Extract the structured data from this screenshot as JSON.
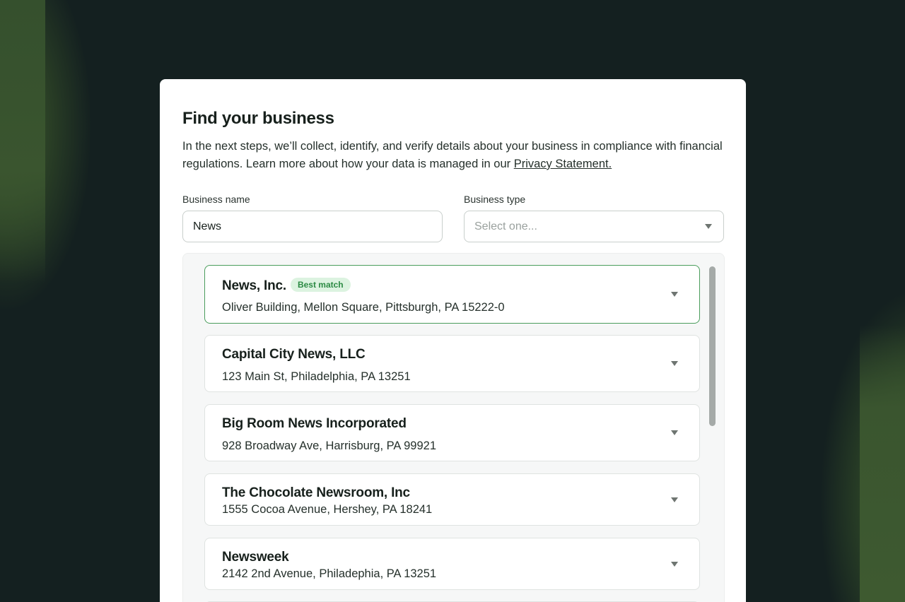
{
  "dialog": {
    "title": "Find your business",
    "intro_text": "In the next steps, we’ll collect, identify, and verify details about your business in compliance with financial regulations. Learn more about how your data is managed in our ",
    "privacy_link": "Privacy Statement."
  },
  "form": {
    "business_name_label": "Business name",
    "business_name_value": "News",
    "business_type_label": "Business type",
    "business_type_placeholder": "Select one..."
  },
  "results": [
    {
      "name": "News, Inc.",
      "badge": "Best match",
      "address": "Oliver Building, Mellon Square, Pittsburgh, PA 15222-0"
    },
    {
      "name": "Capital City News, LLC",
      "address": "123 Main St, Philadelphia, PA 13251"
    },
    {
      "name": "Big Room News Incorporated",
      "address": "928 Broadway Ave, Harrisburg, PA 99921"
    },
    {
      "name": "The Chocolate Newsroom, Inc",
      "address": "1555 Cocoa Avenue, Hershey, PA 18241"
    },
    {
      "name": "Newsweek",
      "address": "2142 2nd Avenue, Philadephia, PA 13251"
    }
  ],
  "colors": {
    "background": "#142020",
    "accent_green": "#4a9d5c",
    "badge_bg": "#dcf3e0",
    "badge_text": "#2b8a43"
  },
  "icons": {
    "select_caret": "chevron-down-icon",
    "result_expand": "chevron-down-icon"
  }
}
